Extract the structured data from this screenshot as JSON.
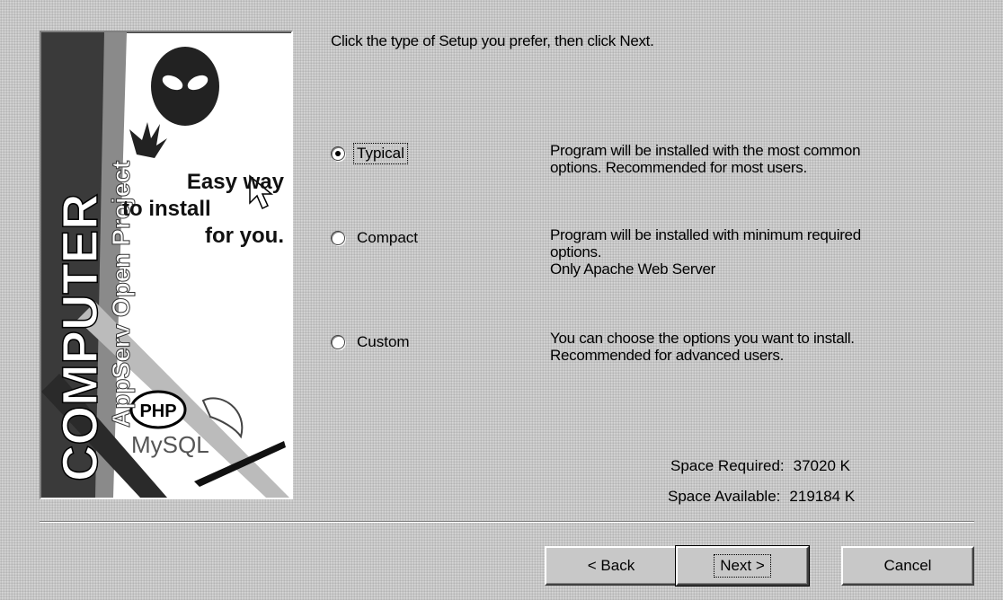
{
  "banner": {
    "logo_text": "COMPUTER",
    "product_text": "AppServ Open Project",
    "slogan_line1": "Easy way",
    "slogan_line2": "to install",
    "slogan_line3": "for you.",
    "php_label": "PHP",
    "mysql_label": "MySQL"
  },
  "instruction": "Click the type of Setup you prefer, then click Next.",
  "options": [
    {
      "label": "Typical",
      "selected": true,
      "desc": [
        "Program will be installed with the most common",
        "options. Recommended for most users."
      ]
    },
    {
      "label": "Compact",
      "selected": false,
      "desc": [
        "Program will be installed with minimum required",
        "options.",
        "Only Apache Web Server"
      ]
    },
    {
      "label": "Custom",
      "selected": false,
      "desc": [
        "You can choose the options you want to install.",
        "Recommended for advanced users."
      ]
    }
  ],
  "space": {
    "required_label": "Space Required:",
    "required_value": "37020 K",
    "available_label": "Space Available:",
    "available_value": "219184 K"
  },
  "buttons": {
    "back": "< Back",
    "next": "Next >",
    "cancel": "Cancel"
  }
}
